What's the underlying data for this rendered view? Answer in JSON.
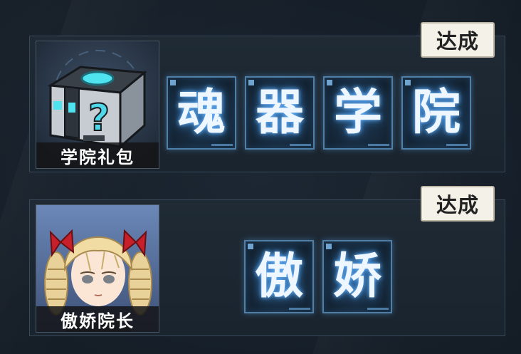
{
  "rows": [
    {
      "status": "达成",
      "item_label": "学院礼包",
      "item_icon": "mystery-box-icon",
      "tiles": [
        "魂",
        "器",
        "学",
        "院"
      ]
    },
    {
      "status": "达成",
      "item_label": "傲娇院长",
      "item_icon": "character-portrait-icon",
      "tiles": [
        "傲",
        "娇"
      ]
    }
  ]
}
